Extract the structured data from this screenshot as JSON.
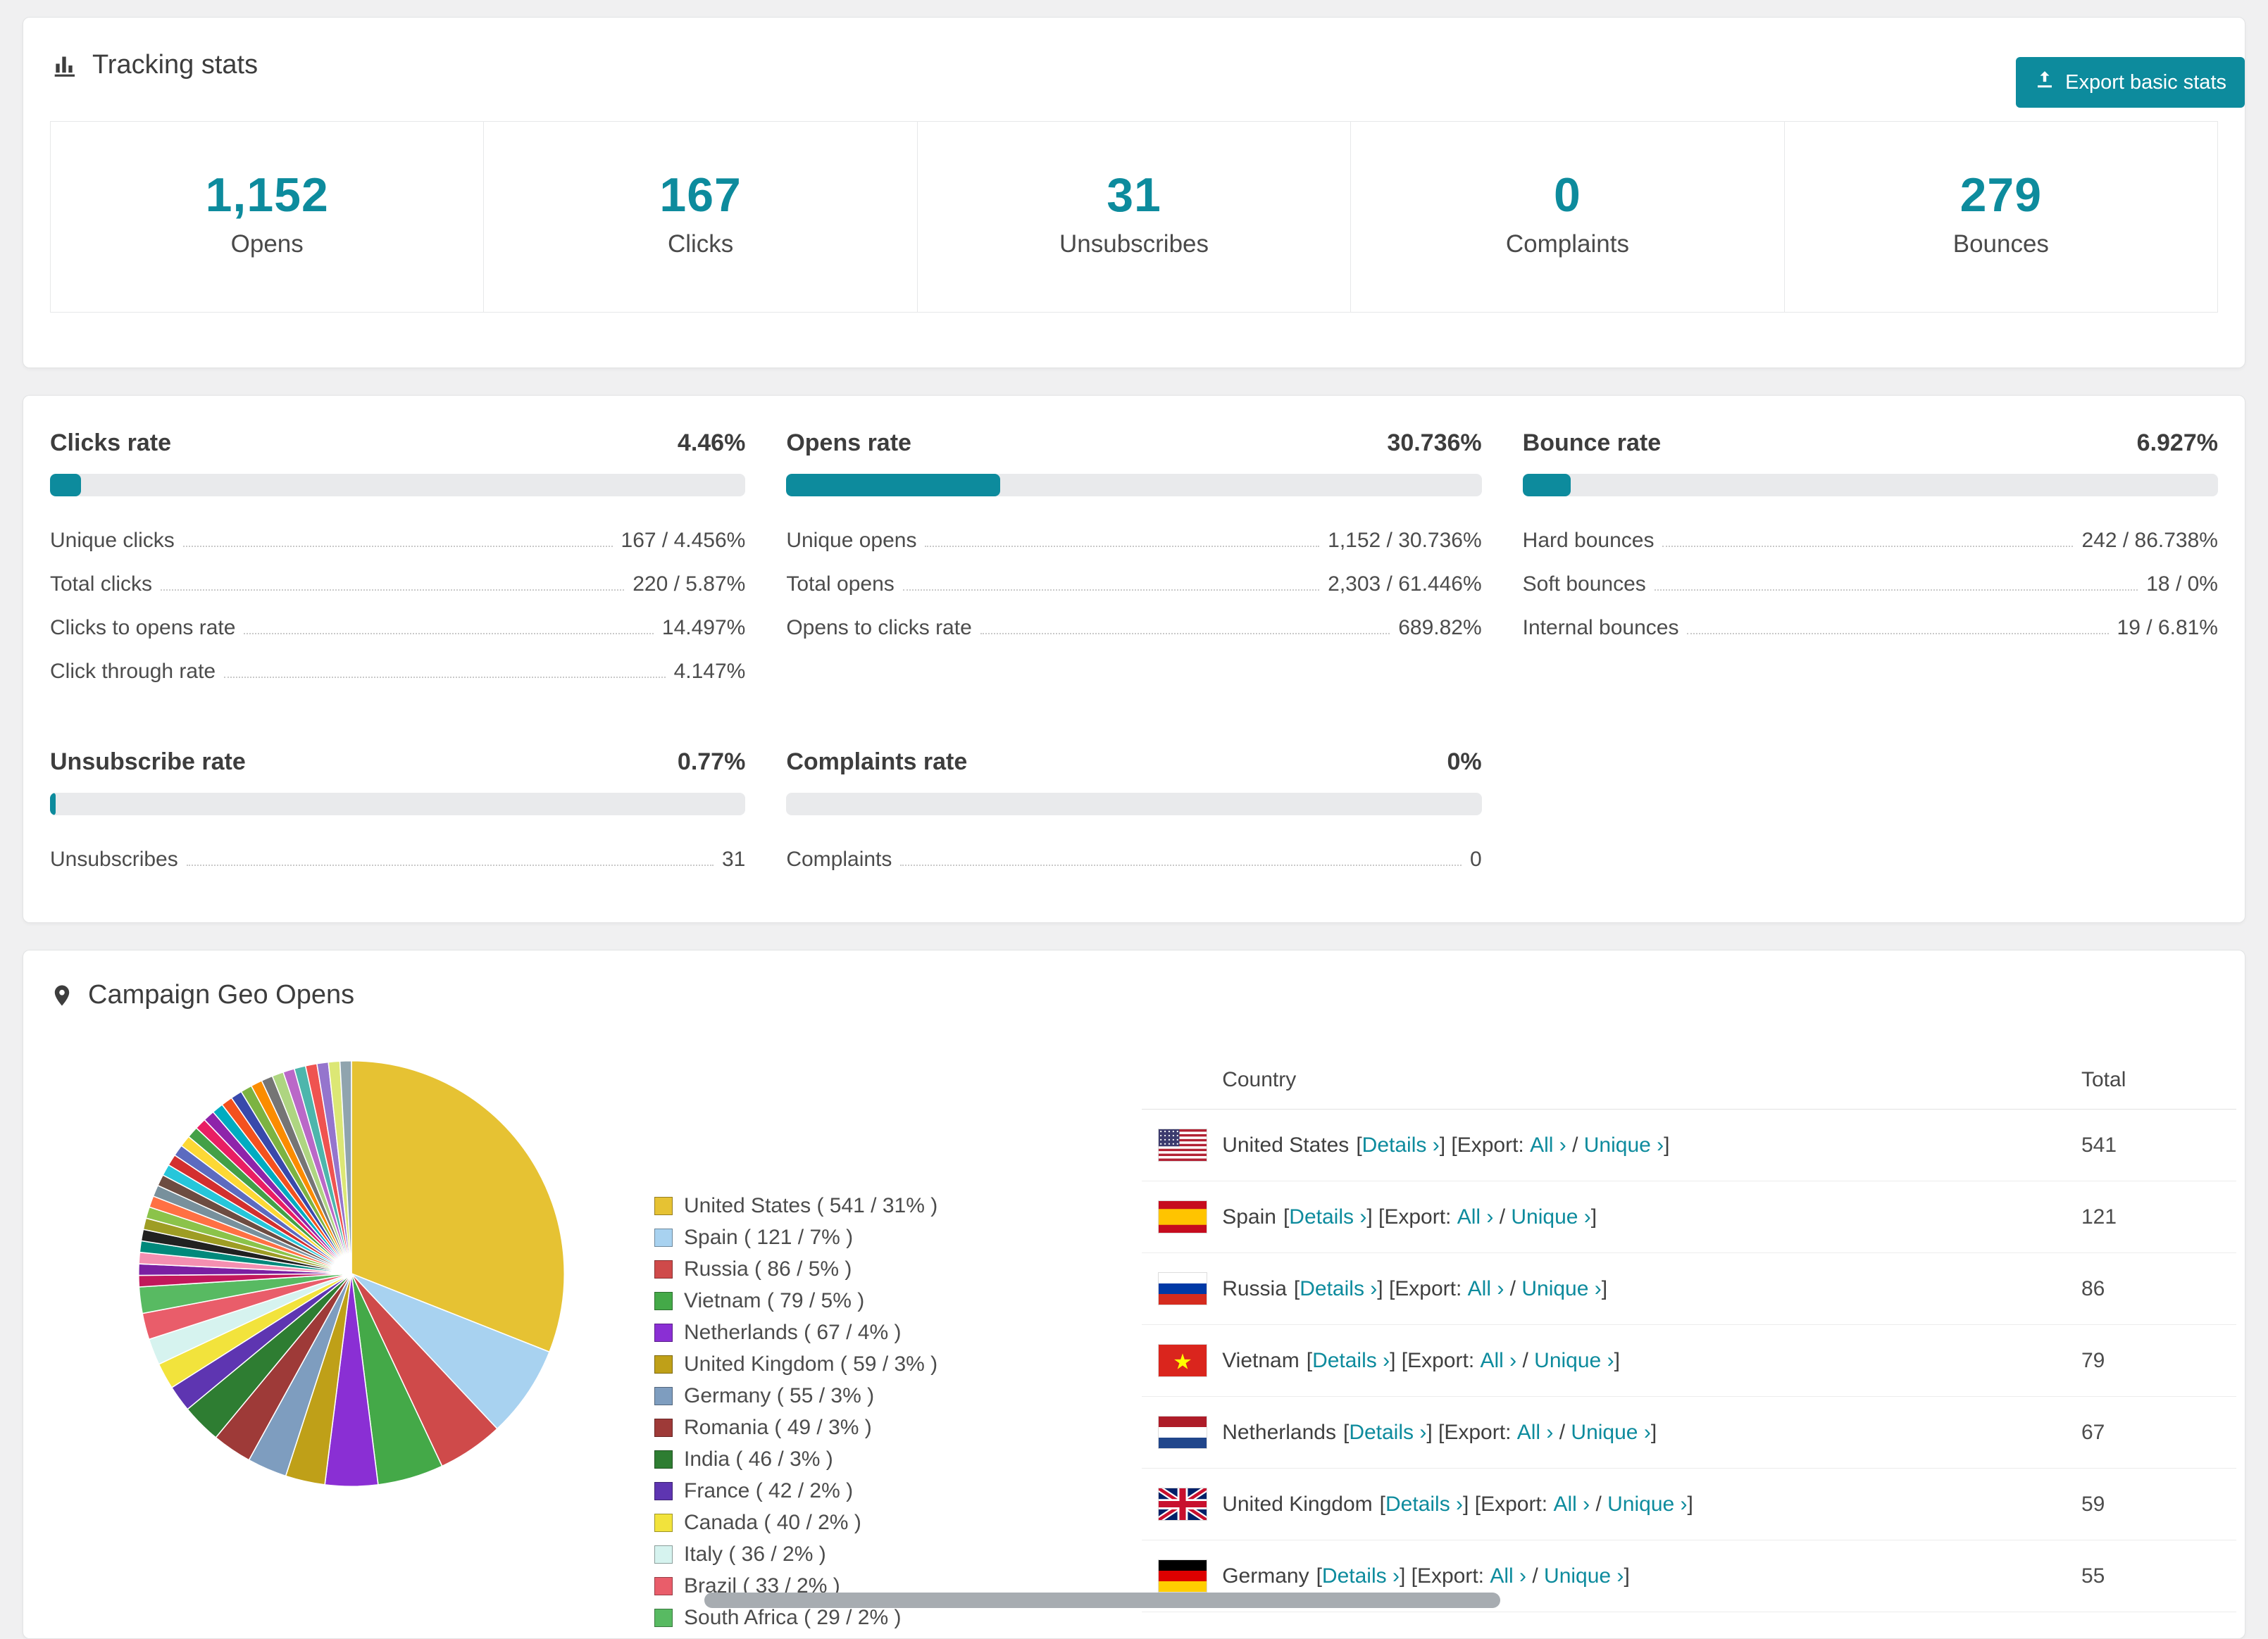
{
  "colors": {
    "accent": "#0d8b9d",
    "page_background": "#f0f0f1"
  },
  "tracking": {
    "title": "Tracking stats",
    "icon": "bar-chart-icon",
    "export_button_label": "Export basic stats",
    "stats": [
      {
        "value": "1,152",
        "label": "Opens"
      },
      {
        "value": "167",
        "label": "Clicks"
      },
      {
        "value": "31",
        "label": "Unsubscribes"
      },
      {
        "value": "0",
        "label": "Complaints"
      },
      {
        "value": "279",
        "label": "Bounces"
      }
    ]
  },
  "rates": [
    {
      "title": "Clicks rate",
      "percent": "4.46%",
      "bar": 4.46,
      "rows": [
        {
          "label": "Unique clicks",
          "value": "167 / 4.456%"
        },
        {
          "label": "Total clicks",
          "value": "220 / 5.87%"
        },
        {
          "label": "Clicks to opens rate",
          "value": "14.497%"
        },
        {
          "label": "Click through rate",
          "value": "4.147%"
        }
      ]
    },
    {
      "title": "Opens rate",
      "percent": "30.736%",
      "bar": 30.736,
      "rows": [
        {
          "label": "Unique opens",
          "value": "1,152 / 30.736%"
        },
        {
          "label": "Total opens",
          "value": "2,303 / 61.446%"
        },
        {
          "label": "Opens to clicks rate",
          "value": "689.82%"
        }
      ]
    },
    {
      "title": "Bounce rate",
      "percent": "6.927%",
      "bar": 6.927,
      "rows": [
        {
          "label": "Hard bounces",
          "value": "242 / 86.738%"
        },
        {
          "label": "Soft bounces",
          "value": "18 / 0%"
        },
        {
          "label": "Internal bounces",
          "value": "19 / 6.81%"
        }
      ]
    },
    {
      "title": "Unsubscribe rate",
      "percent": "0.77%",
      "bar": 0.77,
      "rows": [
        {
          "label": "Unsubscribes",
          "value": "31"
        }
      ]
    },
    {
      "title": "Complaints rate",
      "percent": "0%",
      "bar": 0,
      "rows": [
        {
          "label": "Complaints",
          "value": "0"
        }
      ]
    }
  ],
  "geo": {
    "title": "Campaign Geo Opens",
    "icon": "map-pin-icon",
    "table": {
      "headers": {
        "country": "Country",
        "total": "Total"
      },
      "link_labels": {
        "details": "Details",
        "export_prefix": "Export:",
        "all": "All",
        "unique": "Unique"
      },
      "rows": [
        {
          "country": "United States",
          "flag": "us",
          "total": "541"
        },
        {
          "country": "Spain",
          "flag": "es",
          "total": "121"
        },
        {
          "country": "Russia",
          "flag": "ru",
          "total": "86"
        },
        {
          "country": "Vietnam",
          "flag": "vn",
          "total": "79"
        },
        {
          "country": "Netherlands",
          "flag": "nl",
          "total": "67"
        },
        {
          "country": "United Kingdom",
          "flag": "gb",
          "total": "59"
        },
        {
          "country": "Germany",
          "flag": "de",
          "total": "55"
        }
      ]
    }
  },
  "chart_data": {
    "type": "pie",
    "title": "Campaign Geo Opens",
    "legend_position": "right-of-pie",
    "unit": "opens",
    "slices": [
      {
        "label": "United States",
        "count": 541,
        "percent": 31,
        "color": "#e6c233"
      },
      {
        "label": "Spain",
        "count": 121,
        "percent": 7,
        "color": "#a8d2f0"
      },
      {
        "label": "Russia",
        "count": 86,
        "percent": 5,
        "color": "#cf4a4a"
      },
      {
        "label": "Vietnam",
        "count": 79,
        "percent": 5,
        "color": "#44a948"
      },
      {
        "label": "Netherlands",
        "count": 67,
        "percent": 4,
        "color": "#8a2fd4"
      },
      {
        "label": "United Kingdom",
        "count": 59,
        "percent": 3,
        "color": "#bfa018"
      },
      {
        "label": "Germany",
        "count": 55,
        "percent": 3,
        "color": "#7e9dbf"
      },
      {
        "label": "Romania",
        "count": 49,
        "percent": 3,
        "color": "#9e3a38"
      },
      {
        "label": "India",
        "count": 46,
        "percent": 3,
        "color": "#2e7d32"
      },
      {
        "label": "France",
        "count": 42,
        "percent": 2,
        "color": "#5e35b1"
      },
      {
        "label": "Canada",
        "count": 40,
        "percent": 2,
        "color": "#f2e33c"
      },
      {
        "label": "Italy",
        "count": 36,
        "percent": 2,
        "color": "#d6f3ef"
      },
      {
        "label": "Brazil",
        "count": 33,
        "percent": 2,
        "color": "#e95d6a"
      },
      {
        "label": "South Africa",
        "count": 29,
        "percent": 2,
        "color": "#58ba62"
      }
    ],
    "other_slices": {
      "percent_total": 26,
      "colors": [
        "#c2185b",
        "#7b1fa2",
        "#f48fb1",
        "#00897b",
        "#212121",
        "#9e9d24",
        "#8bc34a",
        "#ff7043",
        "#78909c",
        "#6d4c41",
        "#26c6da",
        "#d32f2f",
        "#5c6bc0",
        "#fdd835",
        "#43a047",
        "#e91e63",
        "#8e24aa",
        "#00acc1",
        "#f4511e",
        "#3949ab",
        "#7cb342",
        "#fb8c00",
        "#757575",
        "#aed581",
        "#ba68c8",
        "#4db6ac",
        "#ef5350",
        "#9575cd",
        "#dce775",
        "#90a4ae"
      ]
    }
  }
}
